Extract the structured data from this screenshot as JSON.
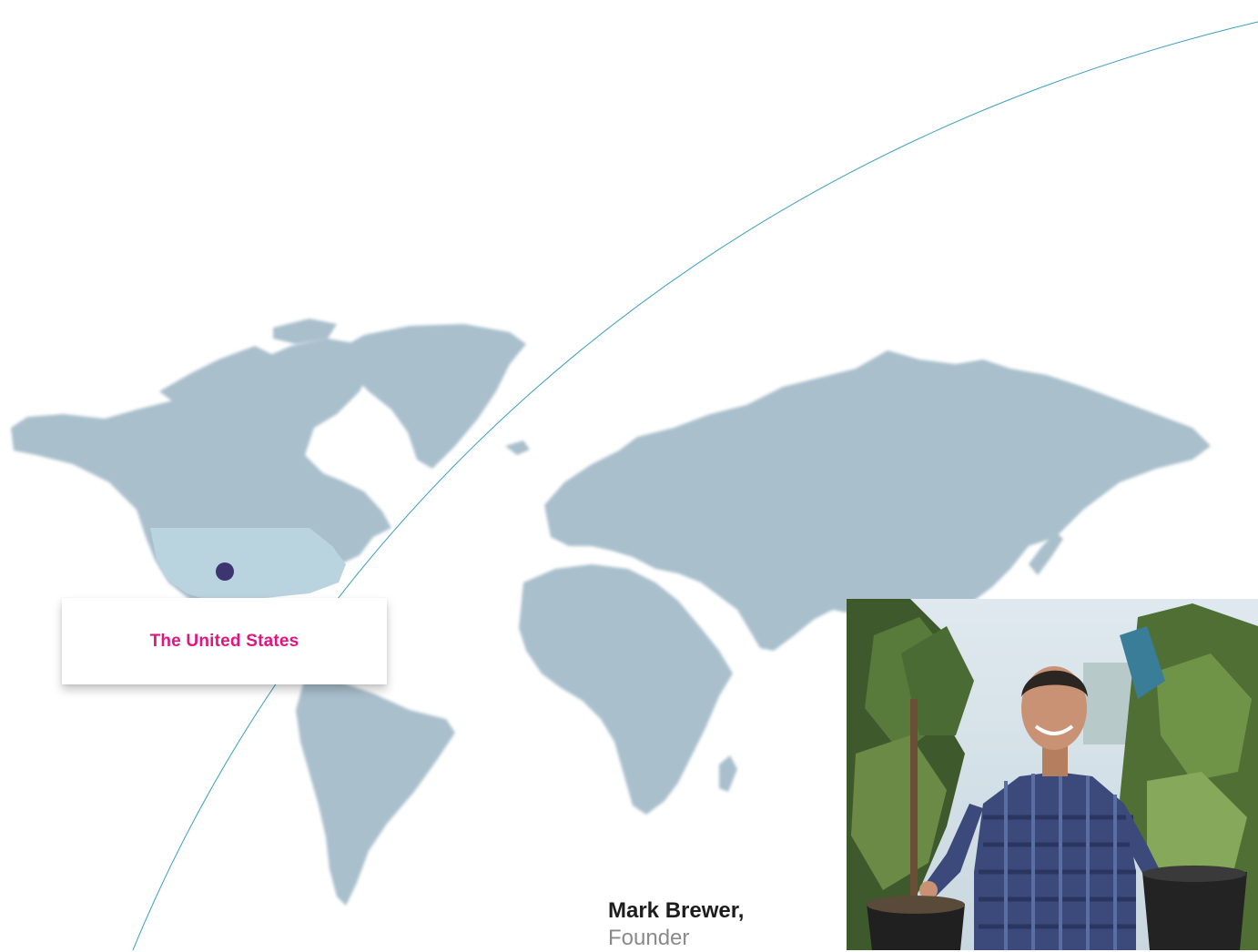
{
  "location": {
    "label": "The United States",
    "label_color": "#e0157d"
  },
  "person": {
    "name": "Mark Brewer,",
    "role": "Founder"
  },
  "colors": {
    "land": "#a9bfcc",
    "highlight": "#b9d3df",
    "marker": "#3d3571",
    "arc": "#3a9ec0"
  }
}
